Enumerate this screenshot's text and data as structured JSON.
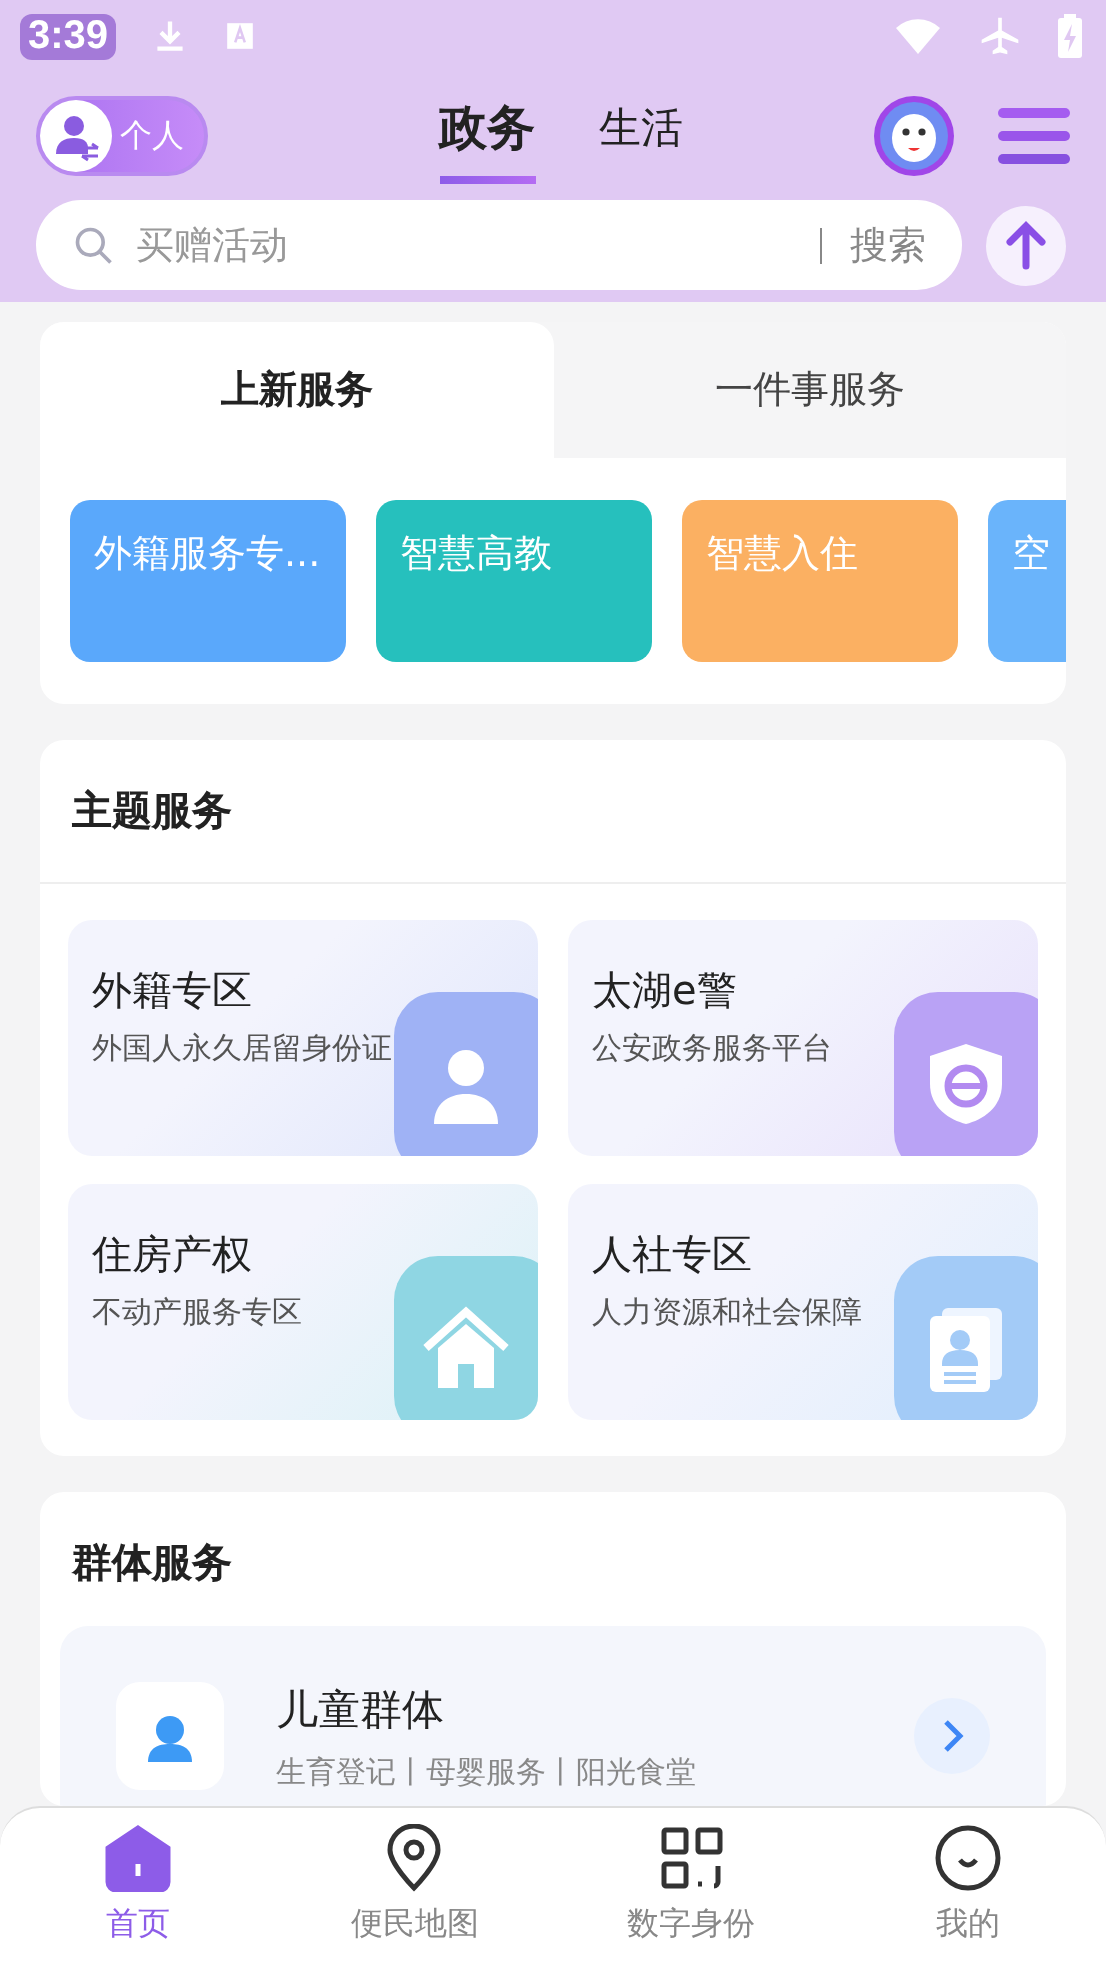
{
  "status_bar": {
    "time": "3:39"
  },
  "header": {
    "mode_label": "个人",
    "tabs": [
      {
        "label": "政务",
        "selected": true
      },
      {
        "label": "生活",
        "selected": false
      }
    ]
  },
  "search": {
    "placeholder": "买赠活动",
    "button": "搜索"
  },
  "service_tabs": [
    {
      "label": "上新服务",
      "selected": true
    },
    {
      "label": "一件事服务",
      "selected": false
    }
  ],
  "service_tiles": [
    {
      "label": "外籍服务专...",
      "color": "#5aa8fb"
    },
    {
      "label": "智慧高教",
      "color": "#26c0bd"
    },
    {
      "label": "智慧入住",
      "color": "#fbb062"
    },
    {
      "label": "空",
      "color": "#6ab4fb"
    }
  ],
  "theme_services": {
    "title": "主题服务",
    "items": [
      {
        "title": "外籍专区",
        "subtitle": "外国人永久居留身份证",
        "color": "#9fb2f5",
        "kind": "person"
      },
      {
        "title": "太湖e警",
        "subtitle": "公安政务服务平台",
        "color": "#b9a2f5",
        "kind": "shield"
      },
      {
        "title": "住房产权",
        "subtitle": "不动产服务专区",
        "color": "#8fd6e3",
        "kind": "house"
      },
      {
        "title": "人社专区",
        "subtitle": "人力资源和社会保障",
        "color": "#a3cbf7",
        "kind": "card"
      }
    ]
  },
  "group_services": {
    "title": "群体服务",
    "items": [
      {
        "title": "儿童群体",
        "subtitle": "生育登记丨母婴服务丨阳光食堂"
      }
    ]
  },
  "bottom_nav": [
    {
      "label": "首页",
      "selected": true,
      "kind": "home"
    },
    {
      "label": "便民地图",
      "selected": false,
      "kind": "pin"
    },
    {
      "label": "数字身份",
      "selected": false,
      "kind": "qr"
    },
    {
      "label": "我的",
      "selected": false,
      "kind": "smile"
    }
  ]
}
